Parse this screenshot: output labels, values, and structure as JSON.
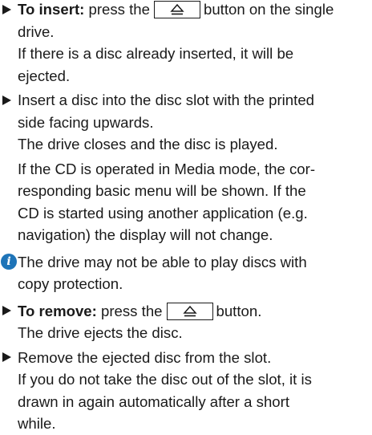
{
  "insert_step": {
    "label": "To insert:",
    "line1_a": "press the",
    "line1_b": "button on the single",
    "line2": "drive.",
    "note_l1": "If there is a disc already inserted, it will be",
    "note_l2": "ejected."
  },
  "disc_step": {
    "l1": "Insert a disc into the disc slot with the printed",
    "l2": "side facing upwards.",
    "l3": "The drive closes and the disc is played."
  },
  "media_note": {
    "l1": "If the CD is operated in Media mode, the cor-",
    "l2": "responding basic menu will be shown. If the",
    "l3": "CD is started using another application (e.g.",
    "l4": "navigation) the display will not change."
  },
  "info_note": {
    "icon": "info-icon",
    "l1": "The drive may not be able to play discs with",
    "l2": "copy protection."
  },
  "remove_step": {
    "label": "To remove:",
    "text_a": "press the",
    "text_b": "button.",
    "l2": "The drive ejects the disc."
  },
  "final_step": {
    "l1": "Remove the ejected disc from the slot.",
    "l2": "If you do not take the disc out of the slot, it is",
    "l3": "drawn in again automatically after a short",
    "l4": "while."
  },
  "colors": {
    "text": "#1a1a1a",
    "info_icon": "#1e74b8"
  }
}
